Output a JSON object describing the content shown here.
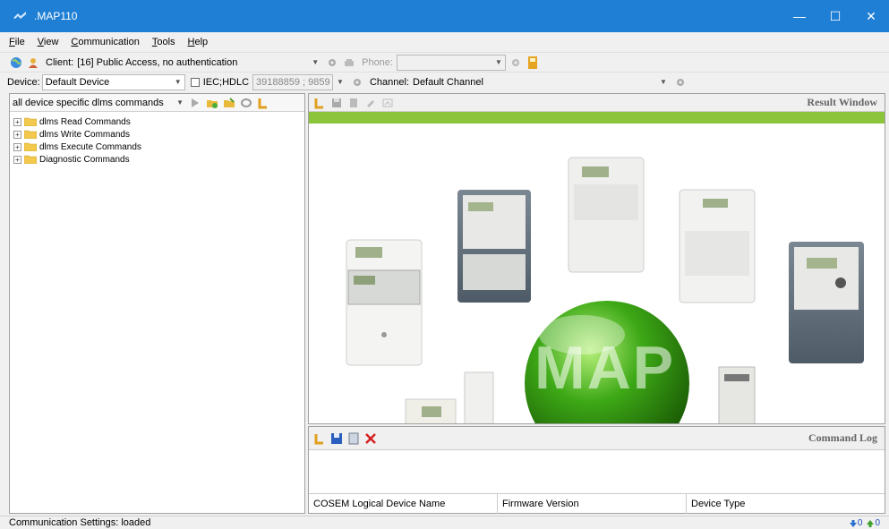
{
  "window": {
    "title": ".MAP110",
    "minimize": "—",
    "maximize": "☐",
    "close": "✕"
  },
  "menu": [
    {
      "label": "File",
      "key": "F",
      "rest": "ile"
    },
    {
      "label": "View",
      "key": "V",
      "rest": "iew"
    },
    {
      "label": "Communication",
      "key": "C",
      "rest": "ommunication"
    },
    {
      "label": "Tools",
      "key": "T",
      "rest": "ools"
    },
    {
      "label": "Help",
      "key": "H",
      "rest": "elp"
    }
  ],
  "toolbar": {
    "client_label": "Client:",
    "client_value": "[16] Public Access, no authentication",
    "phone_label": "Phone:",
    "phone_value": "",
    "device_label": "Device:",
    "device_value": "Default Device",
    "iec_label": "IEC;HDLC",
    "iec_value": "39188859 ; 9859",
    "channel_label": "Channel:",
    "channel_value": "Default Channel"
  },
  "commands": {
    "filter_value": "all device specific dlms commands",
    "tree": [
      {
        "label": "dlms Read Commands",
        "expander": "+"
      },
      {
        "label": "dlms Write Commands",
        "expander": "+"
      },
      {
        "label": "dlms Execute Commands",
        "expander": "+"
      },
      {
        "label": "Diagnostic Commands",
        "expander": "+"
      }
    ]
  },
  "result_window": {
    "title": "Result Window",
    "logo_text": "MAP"
  },
  "command_log": {
    "title": "Command Log",
    "columns": [
      "COSEM Logical Device Name",
      "Firmware Version",
      "Device Type"
    ]
  },
  "status": {
    "text": "Communication Settings: loaded",
    "down_count": "0",
    "up_count": "0"
  },
  "colors": {
    "titlebar": "#1e7fd4",
    "accent_bar": "#8cc43c",
    "logo_green": "#3da816"
  },
  "icons": [
    "globe-icon",
    "client-icon",
    "settings-gear-icon",
    "phone-icon",
    "book-icon",
    "play-icon",
    "open-folder-icon",
    "save-icon",
    "copy-icon",
    "delete-icon"
  ]
}
